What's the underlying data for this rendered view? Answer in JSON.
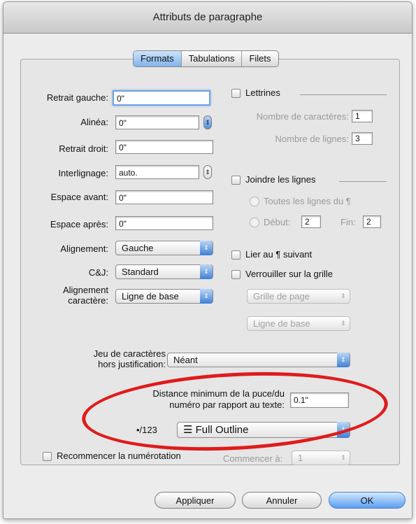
{
  "window": {
    "title": "Attributs de paragraphe"
  },
  "tabs": [
    {
      "label": "Formats"
    },
    {
      "label": "Tabulations"
    },
    {
      "label": "Filets"
    }
  ],
  "left": {
    "retrait_gauche": {
      "label": "Retrait gauche:",
      "value": "0\""
    },
    "alinea": {
      "label": "Alinéa:",
      "value": "0\""
    },
    "retrait_droit": {
      "label": "Retrait droit:",
      "value": "0\""
    },
    "interlignage": {
      "label": "Interlignage:",
      "value": "auto."
    },
    "espace_avant": {
      "label": "Espace avant:",
      "value": "0\""
    },
    "espace_apres": {
      "label": "Espace après:",
      "value": "0\""
    },
    "alignement": {
      "label": "Alignement:",
      "value": "Gauche"
    },
    "cj": {
      "label": "C&J:",
      "value": "Standard"
    },
    "alignement_caractere": {
      "label_line1": "Alignement",
      "label_line2": "caractère:",
      "value": "Ligne de base"
    }
  },
  "right": {
    "lettrines": {
      "label": "Lettrines"
    },
    "nb_caracteres": {
      "label": "Nombre de caractères:",
      "value": "1"
    },
    "nb_lignes": {
      "label": "Nombre de lignes:",
      "value": "3"
    },
    "joindre": {
      "label": "Joindre les lignes"
    },
    "toutes": {
      "label": "Toutes les lignes du ¶"
    },
    "debut": {
      "label": "Début:",
      "value": "2"
    },
    "fin": {
      "label": "Fin:",
      "value": "2"
    },
    "lier": {
      "label": "Lier au ¶ suivant"
    },
    "verrouiller": {
      "label": "Verrouiller sur la grille"
    },
    "grille_page": {
      "value": "Grille de page"
    },
    "ligne_base": {
      "value": "Ligne de base"
    }
  },
  "bottom": {
    "jeu": {
      "label_line1": "Jeu de caractères",
      "label_line2": "hors justification:",
      "value": "Néant"
    },
    "distance": {
      "label_line1": "Distance minimum de la puce/du",
      "label_line2": "numéro par rapport au texte:",
      "value": "0.1\""
    },
    "numbering": {
      "label": "•/123",
      "value": "Full Outline",
      "icon_glyph": "☰"
    },
    "recommencer": {
      "label": "Recommencer la numérotation"
    },
    "commencer": {
      "label": "Commencer à:",
      "value": "1"
    }
  },
  "buttons": {
    "appliquer": "Appliquer",
    "annuler": "Annuler",
    "ok": "OK"
  },
  "colors": {
    "accent": "#5b9ef2",
    "highlight_ellipse": "#e01b1b"
  },
  "icons": {
    "stepper": "up-down-stepper-icon",
    "popup_arrow": "popup-arrows-icon",
    "list_style": "list-style-icon"
  }
}
